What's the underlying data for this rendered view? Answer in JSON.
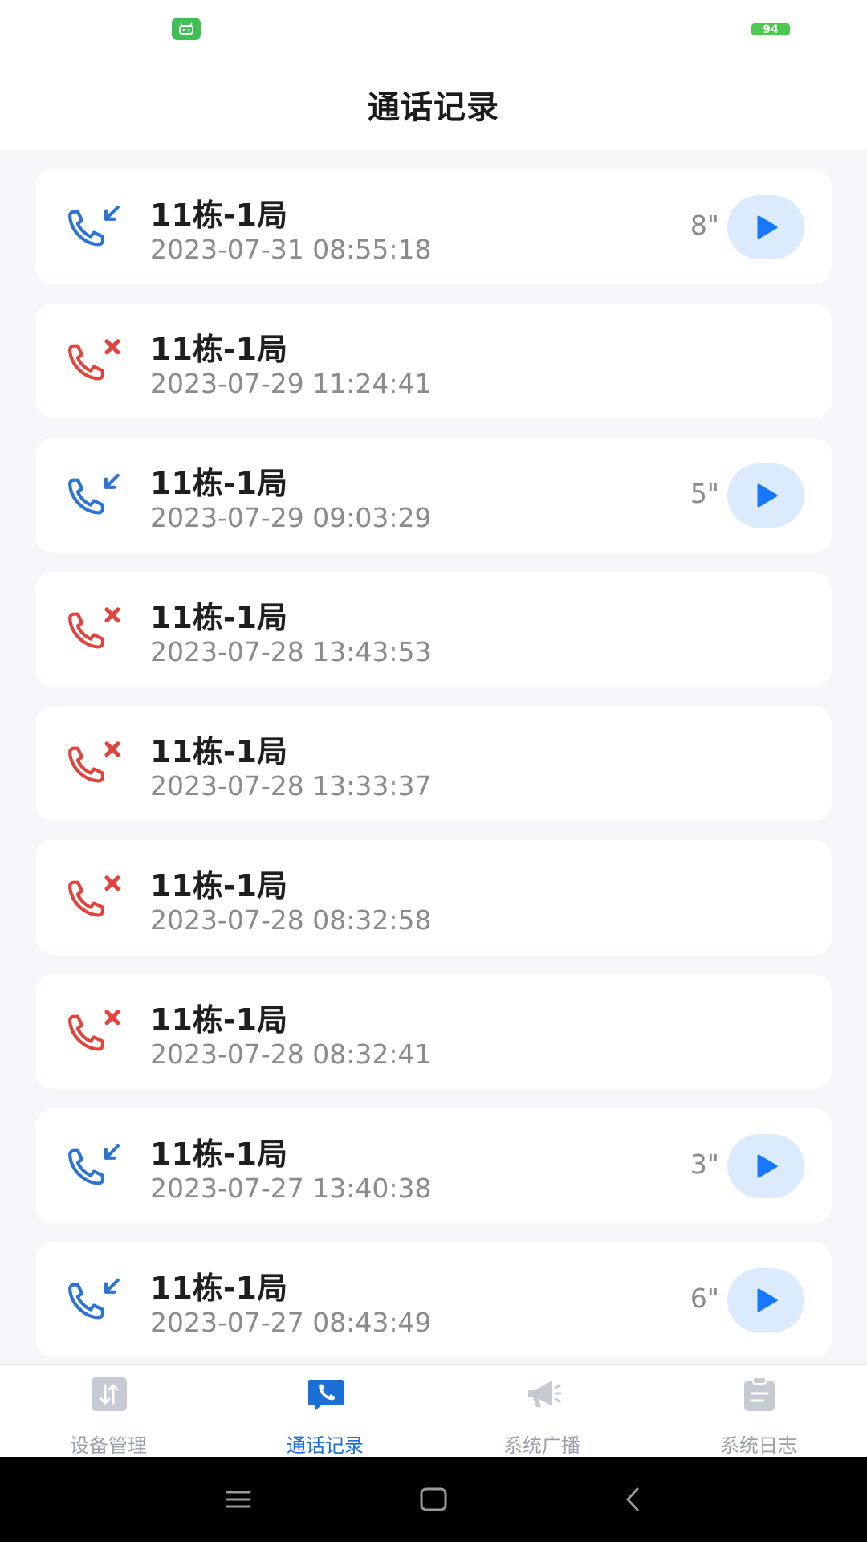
{
  "status_bar": {
    "battery": "94"
  },
  "header": {
    "title": "通话记录"
  },
  "calls": [
    {
      "type": "incoming",
      "name": "11栋-1局",
      "time": "2023-07-31 08:55:18",
      "duration": "8\""
    },
    {
      "type": "missed",
      "name": "11栋-1局",
      "time": "2023-07-29 11:24:41",
      "duration": ""
    },
    {
      "type": "incoming",
      "name": "11栋-1局",
      "time": "2023-07-29 09:03:29",
      "duration": "5\""
    },
    {
      "type": "missed",
      "name": "11栋-1局",
      "time": "2023-07-28 13:43:53",
      "duration": ""
    },
    {
      "type": "missed",
      "name": "11栋-1局",
      "time": "2023-07-28 13:33:37",
      "duration": ""
    },
    {
      "type": "missed",
      "name": "11栋-1局",
      "time": "2023-07-28 08:32:58",
      "duration": ""
    },
    {
      "type": "missed",
      "name": "11栋-1局",
      "time": "2023-07-28 08:32:41",
      "duration": ""
    },
    {
      "type": "incoming",
      "name": "11栋-1局",
      "time": "2023-07-27 13:40:38",
      "duration": "3\""
    },
    {
      "type": "incoming",
      "name": "11栋-1局",
      "time": "2023-07-27 08:43:49",
      "duration": "6\""
    }
  ],
  "tabs": [
    {
      "label": "设备管理",
      "icon": "device-management-icon",
      "active": false
    },
    {
      "label": "通话记录",
      "icon": "phone-chat-icon",
      "active": true
    },
    {
      "label": "系统广播",
      "icon": "megaphone-icon",
      "active": false
    },
    {
      "label": "系统日志",
      "icon": "clipboard-icon",
      "active": false
    }
  ],
  "colors": {
    "accent": "#1b6fd6",
    "incoming": "#2c73d2",
    "missed": "#e0443c",
    "play_bg": "#dceafe",
    "play_fg": "#1677ff"
  }
}
